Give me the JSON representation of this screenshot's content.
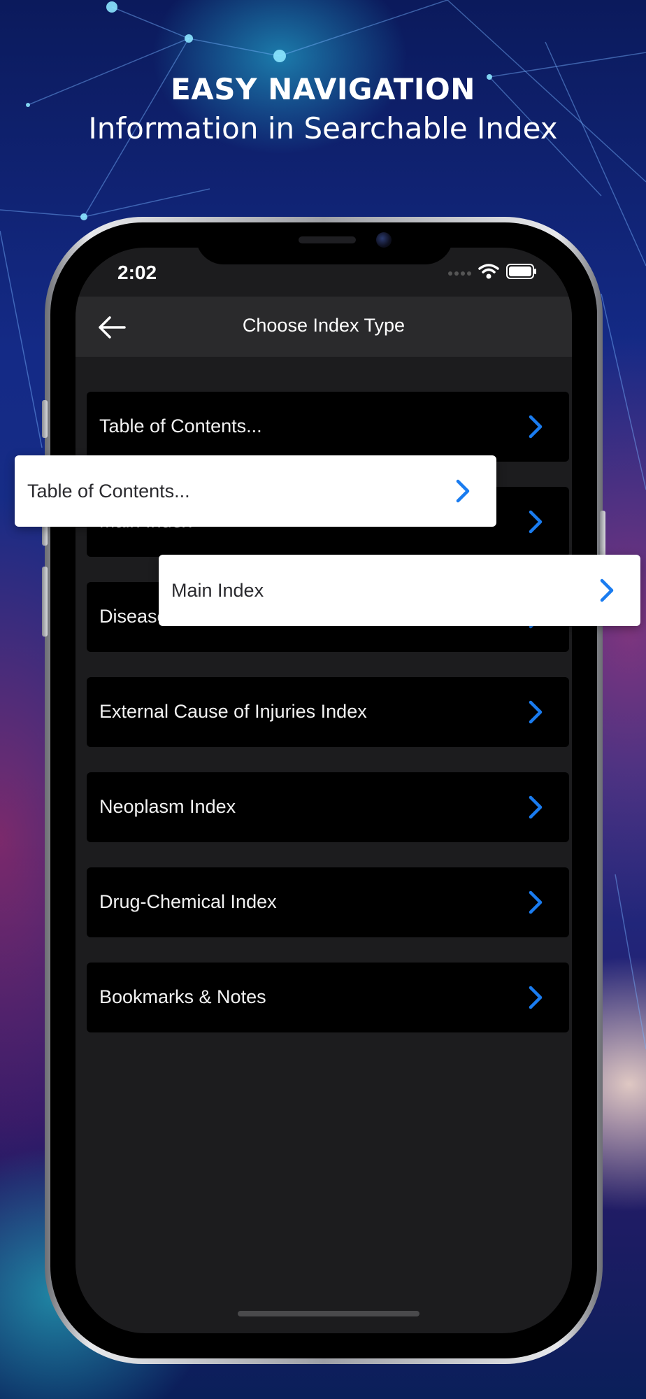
{
  "header": {
    "headline": "EASY NAVIGATION",
    "subheadline": "Information in Searchable Index"
  },
  "status_bar": {
    "time": "2:02"
  },
  "navbar": {
    "title": "Choose Index Type"
  },
  "index_types": [
    {
      "label": "Table of Contents..."
    },
    {
      "label": "Main Index"
    },
    {
      "label": "Disease"
    },
    {
      "label": "External Cause of Injuries Index"
    },
    {
      "label": "Neoplasm Index"
    },
    {
      "label": "Drug-Chemical Index"
    },
    {
      "label": "Bookmarks & Notes"
    }
  ],
  "highlight_cards": [
    {
      "label": "Table of Contents..."
    },
    {
      "label": "Main Index"
    }
  ],
  "colors": {
    "accent": "#1a7cf0",
    "row_background": "#000000",
    "screen_background": "#1c1c1e",
    "navbar_background": "#2a2a2c"
  },
  "icons": {
    "back": "arrow-left-icon",
    "row_chevron": "chevron-right-icon",
    "wifi": "wifi-icon",
    "battery": "battery-icon"
  }
}
